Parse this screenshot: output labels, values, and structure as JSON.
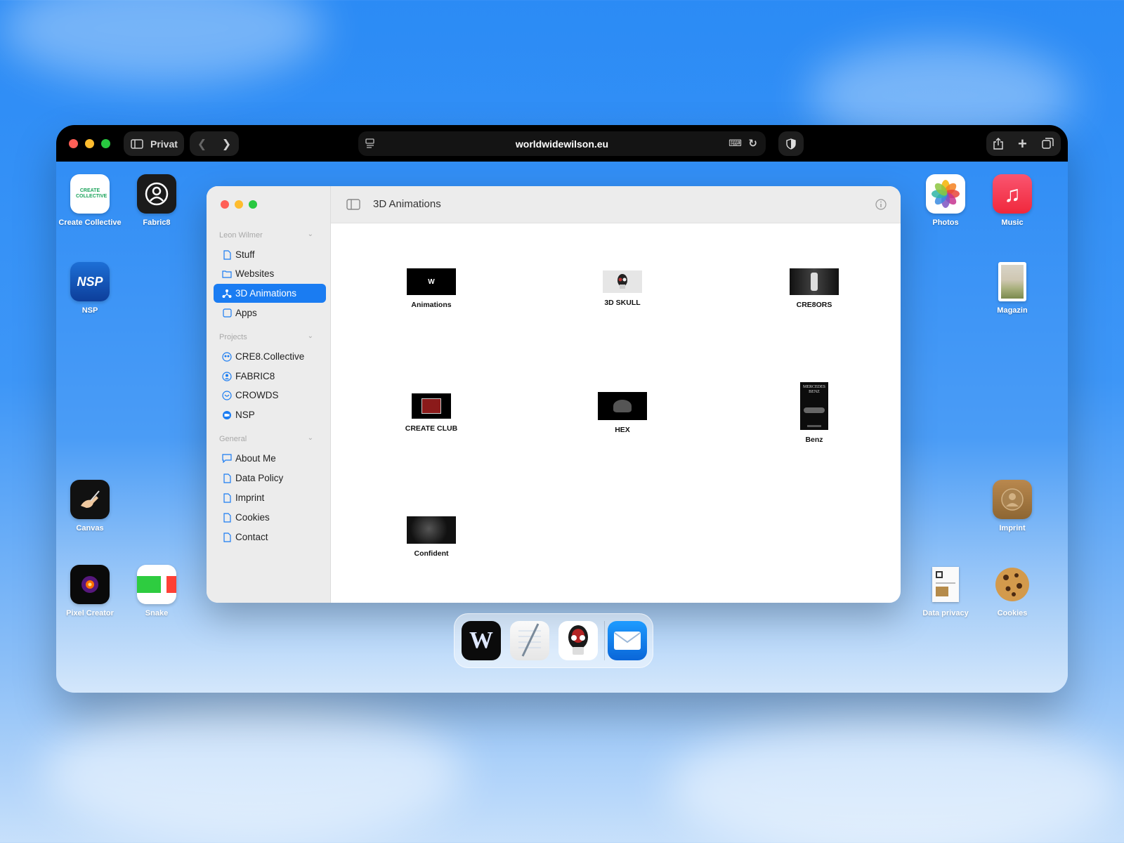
{
  "browser": {
    "profile_label": "Privat",
    "url": "worldwidewilson.eu"
  },
  "desktop_icons": {
    "create_collective": {
      "label": "Create Collective",
      "art_text": "CREATE COLLECTIVE"
    },
    "fabric8": {
      "label": "Fabric8"
    },
    "nsp": {
      "label": "NSP",
      "art_text": "NSP"
    },
    "canvas": {
      "label": "Canvas"
    },
    "pixel_creator": {
      "label": "Pixel Creator"
    },
    "snake": {
      "label": "Snake"
    },
    "photos": {
      "label": "Photos"
    },
    "music": {
      "label": "Music"
    },
    "magazin": {
      "label": "Magazin"
    },
    "imprint": {
      "label": "Imprint"
    },
    "data_privacy": {
      "label": "Data privacy"
    },
    "cookies": {
      "label": "Cookies"
    }
  },
  "finder": {
    "title": "3D Animations",
    "sections": {
      "user": {
        "title": "Leon Wilmer",
        "items": [
          {
            "label": "Stuff"
          },
          {
            "label": "Websites"
          },
          {
            "label": "3D Animations"
          },
          {
            "label": "Apps"
          }
        ]
      },
      "projects": {
        "title": "Projects",
        "items": [
          {
            "label": "CRE8.Collective"
          },
          {
            "label": "FABRIC8"
          },
          {
            "label": "CROWDS"
          },
          {
            "label": "NSP"
          }
        ]
      },
      "general": {
        "title": "General",
        "items": [
          {
            "label": "About Me"
          },
          {
            "label": "Data Policy"
          },
          {
            "label": "Imprint"
          },
          {
            "label": "Cookies"
          },
          {
            "label": "Contact"
          }
        ]
      }
    },
    "files": [
      {
        "label": "Animations"
      },
      {
        "label": "3D SKULL"
      },
      {
        "label": "CRE8ORS"
      },
      {
        "label": "CREATE CLUB"
      },
      {
        "label": "HEX"
      },
      {
        "label": "Benz",
        "art_text": "MERCEDES BENZ"
      },
      {
        "label": "Confident"
      }
    ]
  }
}
